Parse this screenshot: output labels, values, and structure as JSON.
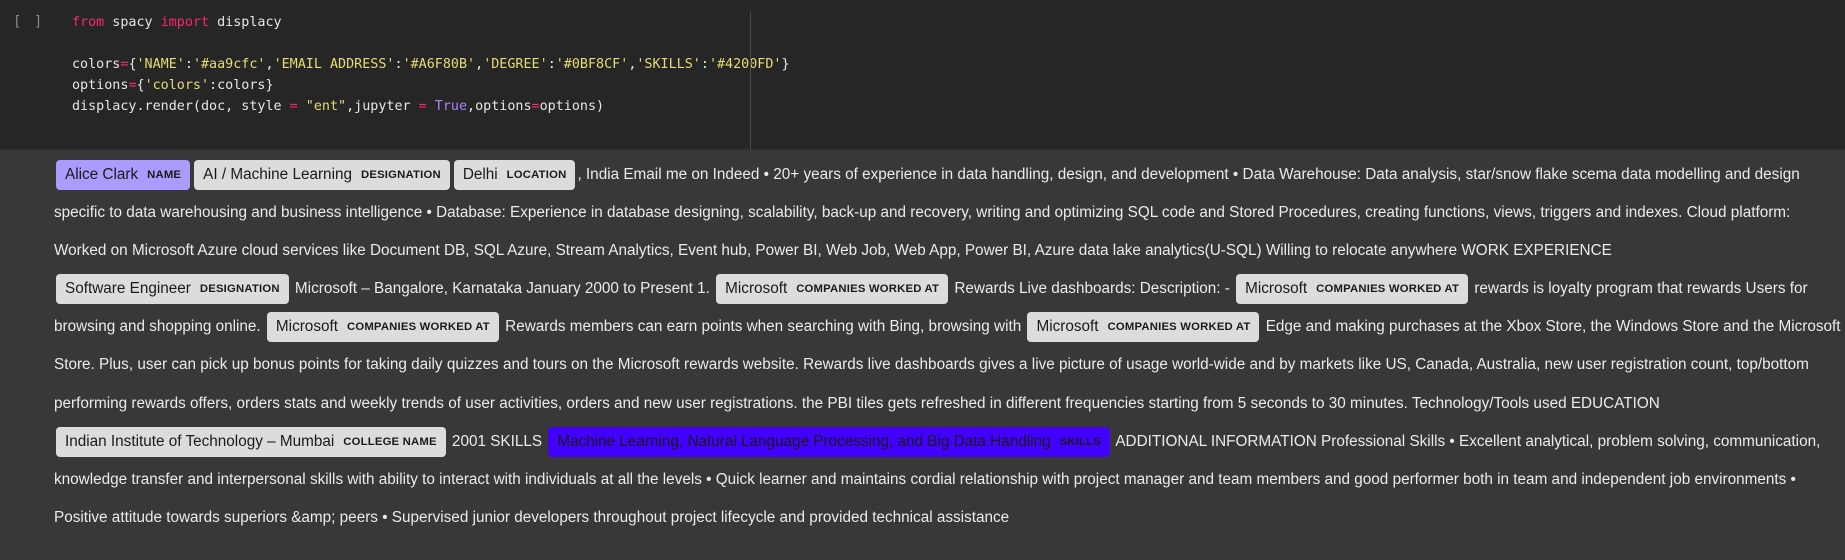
{
  "cell": {
    "prompt": "[ ]",
    "code_tokens": {
      "l1_from": "from",
      "l1_mod": " spacy ",
      "l1_import": "import",
      "l1_name": " displacy",
      "l2_a": "colors",
      "l2_eq": "=",
      "l2_b": "{",
      "l2_k1": "'NAME'",
      "l2_c1": ":",
      "l2_v1": "'#aa9cfc'",
      "l2_c2": ",",
      "l2_k2": "'EMAIL ADDRESS'",
      "l2_c3": ":",
      "l2_v2": "'#A6F80B'",
      "l2_c4": ",",
      "l2_k3": "'DEGREE'",
      "l2_c5": ":",
      "l2_v3": "'#0BF8CF'",
      "l2_c6": ",",
      "l2_k4": "'SKILLS'",
      "l2_c7": ":",
      "l2_v4": "'#4200FD'",
      "l2_end": "}",
      "l3_a": "options",
      "l3_eq": "=",
      "l3_b": "{",
      "l3_k": "'colors'",
      "l3_c": ":colors}",
      "l4_a": "displacy.render(doc, style ",
      "l4_eq1": "=",
      "l4_sp": " ",
      "l4_s": "\"ent\"",
      "l4_b": ",jupyter ",
      "l4_eq2": "=",
      "l4_sp2": " ",
      "l4_true": "True",
      "l4_c": ",options",
      "l4_eq3": "=",
      "l4_d": "options)"
    }
  },
  "colors": {
    "NAME": "#aa9cfc",
    "SKILLS": "#4200fd",
    "default_entity": "#dcdcdc"
  },
  "output": {
    "e1_text": "Alice Clark",
    "e1_label": "NAME",
    "e2_text": "AI / Machine Learning",
    "e2_label": "DESIGNATION",
    "e3_text": "Delhi",
    "e3_label": "LOCATION",
    "t1": ", India Email me on Indeed • 20+ years of experience in data handling, design, and development • Data Warehouse: Data analysis, star/snow flake scema data modelling and design specific to data warehousing and business intelligence • Database: Experience in database designing, scalability, back-up and recovery, writing and optimizing SQL code and Stored Procedures, creating functions, views, triggers and indexes. Cloud platform: Worked on Microsoft Azure cloud services like Document DB, SQL Azure, Stream Analytics, Event hub, Power BI, Web Job, Web App, Power BI, Azure data lake analytics(U-SQL) Willing to relocate anywhere WORK EXPERIENCE ",
    "e4_text": "Software Engineer",
    "e4_label": "DESIGNATION",
    "t2": " Microsoft – Bangalore, Karnataka January 2000 to Present 1. ",
    "e5_text": "Microsoft",
    "e5_label": "COMPANIES WORKED AT",
    "t3": " Rewards Live dashboards: Description: - ",
    "e6_text": "Microsoft",
    "e6_label": "COMPANIES WORKED AT",
    "t4": " rewards is loyalty program that rewards Users for browsing and shopping online. ",
    "e7_text": "Microsoft",
    "e7_label": "COMPANIES WORKED AT",
    "t5": " Rewards members can earn points when searching with Bing, browsing with ",
    "e8_text": "Microsoft",
    "e8_label": "COMPANIES WORKED AT",
    "t6": " Edge and making purchases at the Xbox Store, the Windows Store and the Microsoft Store. Plus, user can pick up bonus points for taking daily quizzes and tours on the Microsoft rewards website. Rewards live dashboards gives a live picture of usage world-wide and by markets like US, Canada, Australia, new user registration count, top/bottom performing rewards offers, orders stats and weekly trends of user activities, orders and new user registrations. the PBI tiles gets refreshed in different frequencies starting from 5 seconds to 30 minutes. Technology/Tools used EDUCATION ",
    "e9_text": "Indian Institute of Technology – Mumbai",
    "e9_label": "COLLEGE NAME",
    "t7": " 2001 SKILLS ",
    "e10_text": "Machine Learning, Natural Language Processing, and Big Data Handling",
    "e10_label": "SKILLS",
    "t8": " ADDITIONAL INFORMATION Professional Skills • Excellent analytical, problem solving, communication, knowledge transfer and interpersonal skills with ability to interact with individuals at all the levels • Quick learner and maintains cordial relationship with project manager and team members and good performer both in team and independent job environments • Positive attitude towards superiors &amp; peers • Supervised junior developers throughout project lifecycle and provided technical assistance"
  }
}
